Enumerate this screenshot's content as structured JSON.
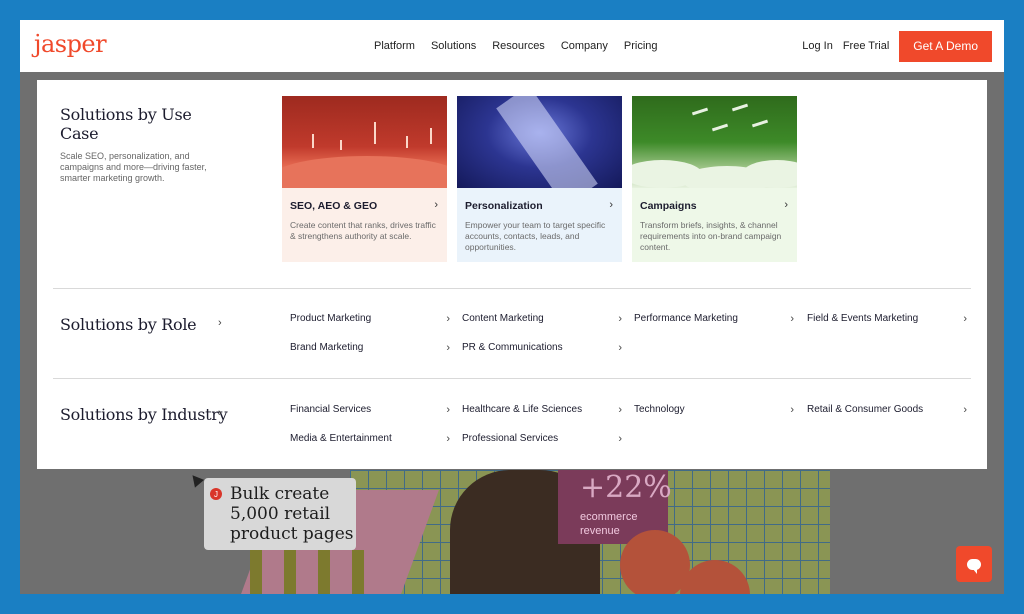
{
  "nav": {
    "logo": "jasper",
    "links": [
      "Platform",
      "Solutions",
      "Resources",
      "Company",
      "Pricing"
    ],
    "login": "Log In",
    "free_trial": "Free Trial",
    "demo": "Get A Demo"
  },
  "use_case": {
    "title": "Solutions by Use Case",
    "description": "Scale SEO, personalization, and campaigns and more—driving faster, smarter marketing growth.",
    "cards": [
      {
        "title": "SEO, AEO & GEO",
        "description": "Create content that ranks, drives traffic & strengthens authority at scale."
      },
      {
        "title": "Personalization",
        "description": "Empower your team to target specific accounts, contacts, leads, and opportunities."
      },
      {
        "title": "Campaigns",
        "description": "Transform briefs, insights, & channel requirements into on-brand campaign content."
      }
    ]
  },
  "role": {
    "title": "Solutions by Role",
    "links": [
      "Product Marketing",
      "Content Marketing",
      "Performance Marketing",
      "Field & Events Marketing",
      "Brand Marketing",
      "PR & Communications"
    ]
  },
  "industry": {
    "title": "Solutions by Industry",
    "links": [
      "Financial Services",
      "Healthcare & Life Sciences",
      "Technology",
      "Retail & Consumer Goods",
      "Media & Entertainment",
      "Professional Services"
    ]
  },
  "chevron": "›",
  "hero": {
    "callout_badge": "J",
    "callout": [
      "Bulk create",
      "5,000 retail",
      "product pages"
    ],
    "stat": "+22%",
    "stat_label": [
      "ecommerce",
      "revenue"
    ]
  },
  "colors": {
    "accent": "#f0492b",
    "frame": "#1a7fc3"
  }
}
